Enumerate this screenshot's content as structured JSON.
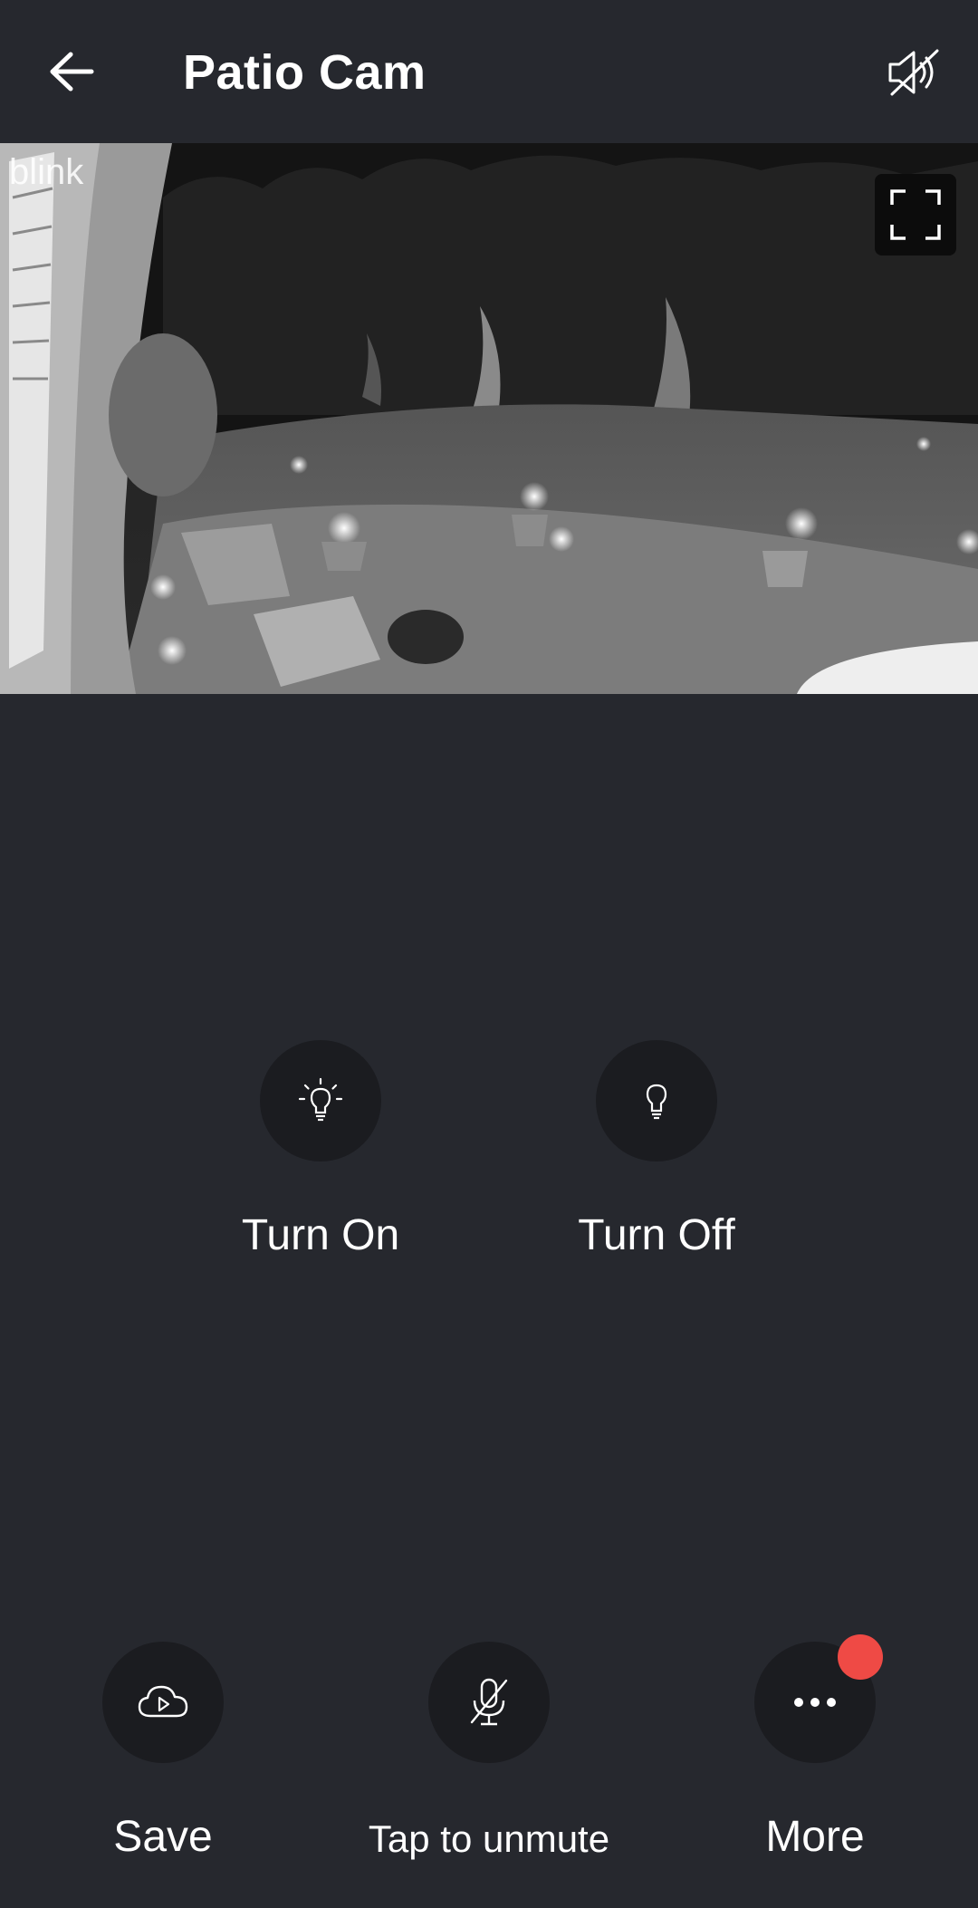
{
  "header": {
    "title": "Patio Cam",
    "back_icon": "arrow-left-icon",
    "mute_icon": "speaker-muted-icon"
  },
  "feed": {
    "watermark": "blink",
    "fullscreen_icon": "fullscreen-icon",
    "mode": "night-vision grayscale"
  },
  "light_controls": {
    "turn_on": {
      "label": "Turn On",
      "icon": "lightbulb-on-icon"
    },
    "turn_off": {
      "label": "Turn Off",
      "icon": "lightbulb-off-icon"
    }
  },
  "bottom_controls": {
    "save": {
      "label": "Save",
      "icon": "cloud-play-icon"
    },
    "unmute": {
      "label": "Tap to unmute",
      "icon": "mic-muted-icon"
    },
    "more": {
      "label": "More",
      "icon": "more-dots-icon",
      "badge": true
    }
  },
  "colors": {
    "background": "#26282e",
    "button": "#1b1c20",
    "badge": "#ef4a45",
    "text": "#ffffff"
  }
}
